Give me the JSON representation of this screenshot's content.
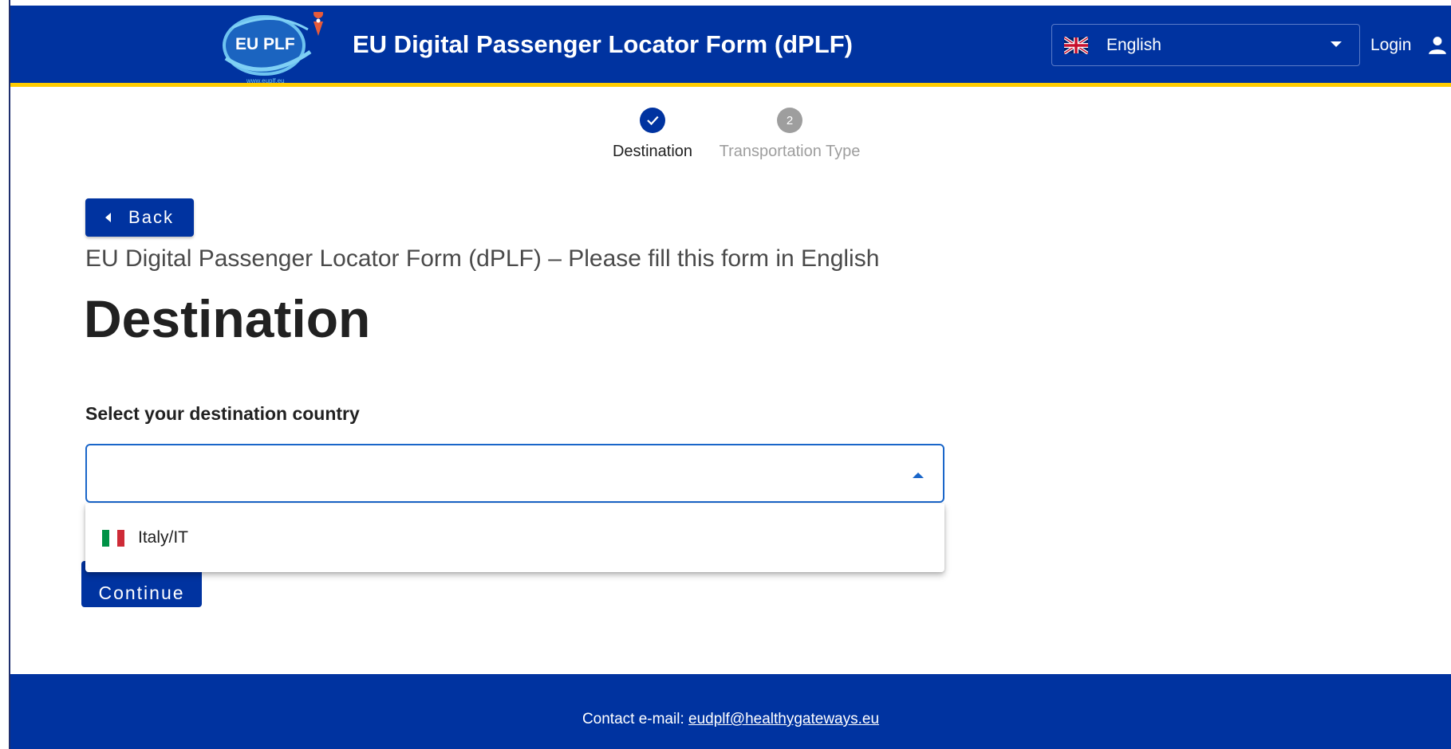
{
  "header": {
    "title": "EU Digital Passenger Locator Form (dPLF)",
    "logo_text": "EU PLF",
    "logo_url_text": "www.euplf.eu",
    "language": {
      "selected": "English",
      "flag_icon": "uk-flag-icon"
    },
    "login_label": "Login"
  },
  "stepper": {
    "steps": [
      {
        "label": "Destination",
        "status": "completed"
      },
      {
        "label": "Transportation Type",
        "number": "2",
        "status": "inactive"
      }
    ]
  },
  "main": {
    "back_label": "Back",
    "subtitle": "EU Digital Passenger Locator Form (dPLF) – Please fill this form in English",
    "title": "Destination",
    "field_label": "Select your destination country",
    "country_input_value": "",
    "dropdown_options": [
      {
        "label": "Italy/IT",
        "flag_icon": "italy-flag-icon"
      }
    ],
    "continue_label": "Continue"
  },
  "footer": {
    "contact_label": "Contact e-mail:",
    "contact_email": "eudplf@healthygateways.eu"
  },
  "colors": {
    "primary": "#0033a0",
    "accent_yellow": "#ffcc00",
    "focus_blue": "#1a66c9",
    "inactive_gray": "#9e9e9e"
  }
}
